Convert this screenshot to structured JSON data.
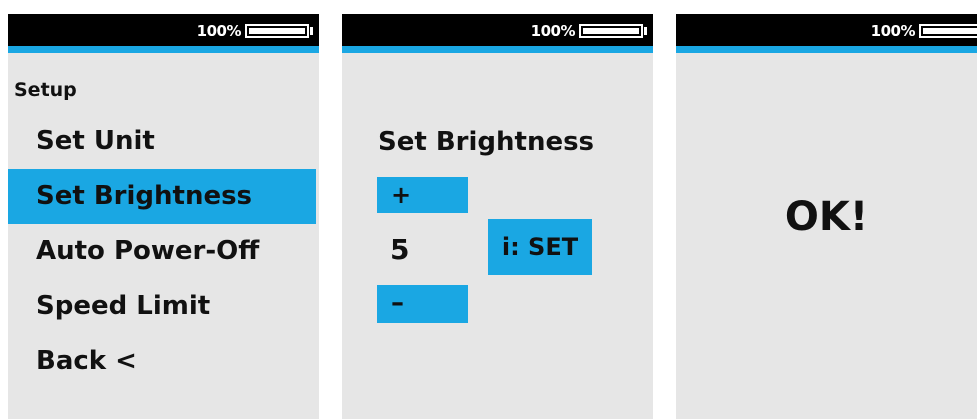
{
  "status_bar": {
    "battery_text": "100%",
    "battery_level": 1.0
  },
  "colors": {
    "accent": "#1aa7e3",
    "screen_background": "#e6e6e6",
    "status_bar": "#000000",
    "text": "#111111"
  },
  "screens": [
    {
      "title": "Setup",
      "menu_items": [
        {
          "label": "Set Unit",
          "selected": false
        },
        {
          "label": "Set Brightness",
          "selected": true
        },
        {
          "label": "Auto Power-Off",
          "selected": false
        },
        {
          "label": "Speed Limit",
          "selected": false
        },
        {
          "label": "Back <",
          "selected": false
        }
      ]
    },
    {
      "title": "Set Brightness",
      "plus_label": "+",
      "value": "5",
      "minus_label": "–",
      "set_label": "i: SET"
    },
    {
      "message": "OK!"
    }
  ],
  "icons": {
    "battery": "battery-icon"
  }
}
